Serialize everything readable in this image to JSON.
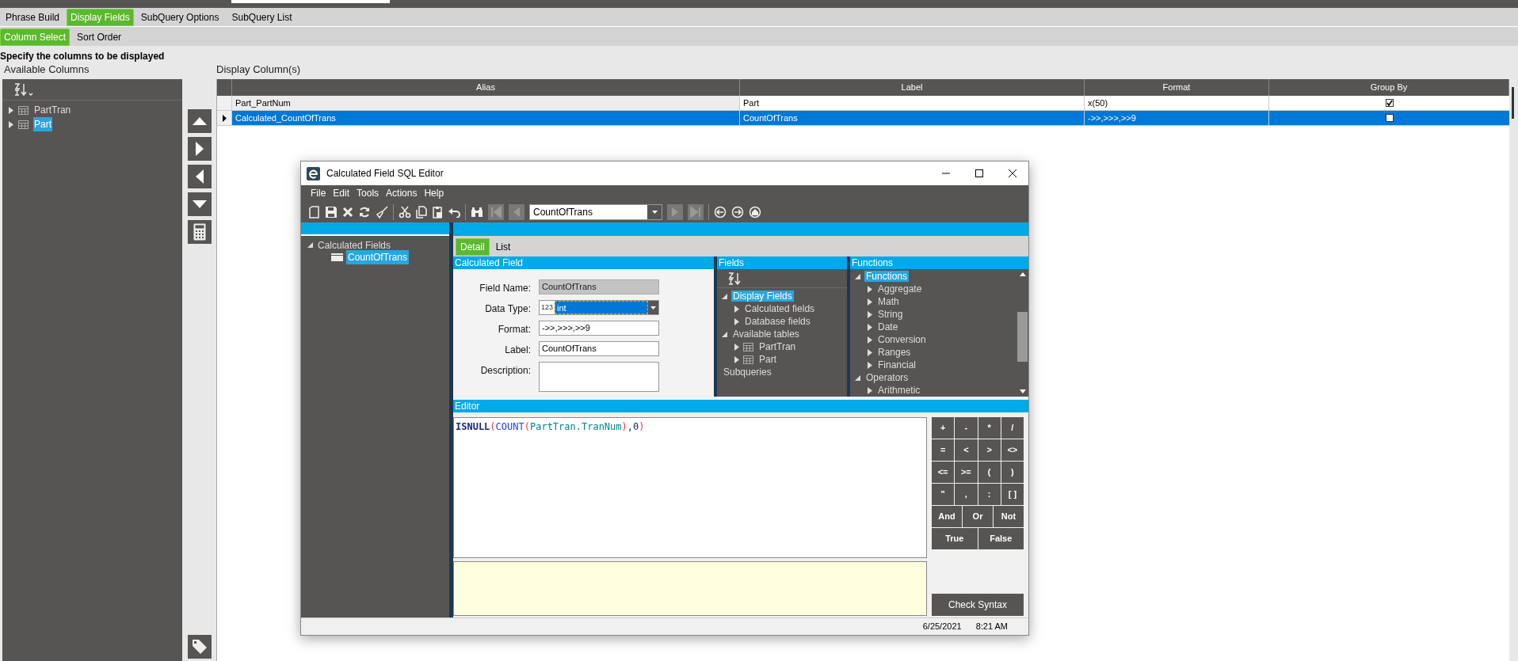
{
  "top_tabs": [
    {
      "label": "Phrase Build",
      "selected": false
    },
    {
      "label": "Display Fields",
      "selected": true
    },
    {
      "label": "SubQuery Options",
      "selected": false
    },
    {
      "label": "SubQuery List",
      "selected": false
    }
  ],
  "sub_tabs": [
    {
      "label": "Column Select",
      "selected": true
    },
    {
      "label": "Sort Order",
      "selected": false
    }
  ],
  "instruction": "Specify the columns to be displayed",
  "available_columns": {
    "title": "Available Columns",
    "tree": [
      {
        "label": "PartTran",
        "selected": false
      },
      {
        "label": "Part",
        "selected": true
      }
    ]
  },
  "display_columns": {
    "title": "Display Column(s)",
    "columns": [
      "Alias",
      "Label",
      "Format",
      "Group By"
    ],
    "rows": [
      {
        "alias": "Part_PartNum",
        "label": "Part",
        "format": "x(50)",
        "group_by": true,
        "selected": false
      },
      {
        "alias": "Calculated_CountOfTrans",
        "label": "CountOfTrans",
        "format": "->>,>>>,>>9",
        "group_by": false,
        "selected": true
      }
    ]
  },
  "dialog": {
    "title": "Calculated Field SQL Editor",
    "menu": [
      "File",
      "Edit",
      "Tools",
      "Actions",
      "Help"
    ],
    "record": "CountOfTrans",
    "tree": [
      {
        "label": "Calculated Fields",
        "expanded": true,
        "selected": false,
        "children": [
          {
            "label": "CountOfTrans",
            "selected": true
          }
        ]
      }
    ],
    "tabs": [
      {
        "label": "Detail",
        "selected": true
      },
      {
        "label": "List",
        "selected": false
      }
    ],
    "calculated_field": {
      "title": "Calculated Field",
      "fields": [
        {
          "label": "Field Name:",
          "kind": "readonly",
          "value": "CountOfTrans"
        },
        {
          "label": "Data Type:",
          "kind": "dropdown",
          "prefix": "123",
          "value": "int"
        },
        {
          "label": "Format:",
          "kind": "text",
          "value": "->>,>>>,>>9"
        },
        {
          "label": "Label:",
          "kind": "text",
          "value": "CountOfTrans"
        },
        {
          "label": "Description:",
          "kind": "textarea"
        }
      ]
    },
    "fields_panel": {
      "title": "Fields",
      "tree": [
        {
          "label": "Display Fields",
          "kind": "folder",
          "expanded": true,
          "selected": true,
          "children": [
            {
              "label": "Calculated fields",
              "kind": "folder",
              "expanded": false,
              "selected": false
            },
            {
              "label": "Database fields",
              "kind": "folder",
              "expanded": false,
              "selected": false
            }
          ]
        },
        {
          "label": "Available tables",
          "kind": "folder",
          "expanded": true,
          "selected": false,
          "children": [
            {
              "label": "PartTran",
              "kind": "table",
              "expanded": false,
              "selected": false
            },
            {
              "label": "Part",
              "kind": "table",
              "expanded": false,
              "selected": false
            }
          ]
        },
        {
          "label": "Subqueries",
          "kind": "leaf",
          "selected": false
        }
      ]
    },
    "functions_panel": {
      "title": "Functions",
      "tree": [
        {
          "label": "Functions",
          "kind": "folder",
          "expanded": true,
          "selected": true,
          "children": [
            {
              "label": "Aggregate",
              "kind": "folder",
              "expanded": false,
              "selected": false
            },
            {
              "label": "Math",
              "kind": "folder",
              "expanded": false,
              "selected": false
            },
            {
              "label": "String",
              "kind": "folder",
              "expanded": false,
              "selected": false
            },
            {
              "label": "Date",
              "kind": "folder",
              "expanded": false,
              "selected": false
            },
            {
              "label": "Conversion",
              "kind": "folder",
              "expanded": false,
              "selected": false
            },
            {
              "label": "Ranges",
              "kind": "folder",
              "expanded": false,
              "selected": false
            },
            {
              "label": "Financial",
              "kind": "folder",
              "expanded": false,
              "selected": false
            }
          ]
        },
        {
          "label": "Operators",
          "kind": "folder",
          "expanded": true,
          "selected": false,
          "children": [
            {
              "label": "Arithmetic",
              "kind": "folder",
              "expanded": false,
              "selected": false
            }
          ]
        }
      ]
    },
    "editor": {
      "title": "Editor",
      "tokens": [
        {
          "text": "ISNULL",
          "kind": "keyword"
        },
        {
          "text": "(",
          "kind": "paren"
        },
        {
          "text": "COUNT",
          "kind": "function"
        },
        {
          "text": "(",
          "kind": "paren"
        },
        {
          "text": "PartTran.TranNum",
          "kind": "field"
        },
        {
          "text": ")",
          "kind": "paren"
        },
        {
          "text": ",",
          "kind": "plain"
        },
        {
          "text": "0",
          "kind": "number"
        },
        {
          "text": ")",
          "kind": "paren"
        }
      ]
    },
    "operators": [
      [
        "+",
        "-",
        "*",
        "/"
      ],
      [
        "=",
        "<",
        ">",
        "<>"
      ],
      [
        "<=",
        ">=",
        "(",
        ")"
      ],
      [
        "\"",
        ",",
        ":",
        "[ ]"
      ],
      [
        "And",
        "Or",
        "Not"
      ],
      [
        "True",
        "False"
      ]
    ],
    "check_syntax": "Check Syntax",
    "status_bar": {
      "date": "6/25/2021",
      "time": "8:21 AM"
    }
  }
}
